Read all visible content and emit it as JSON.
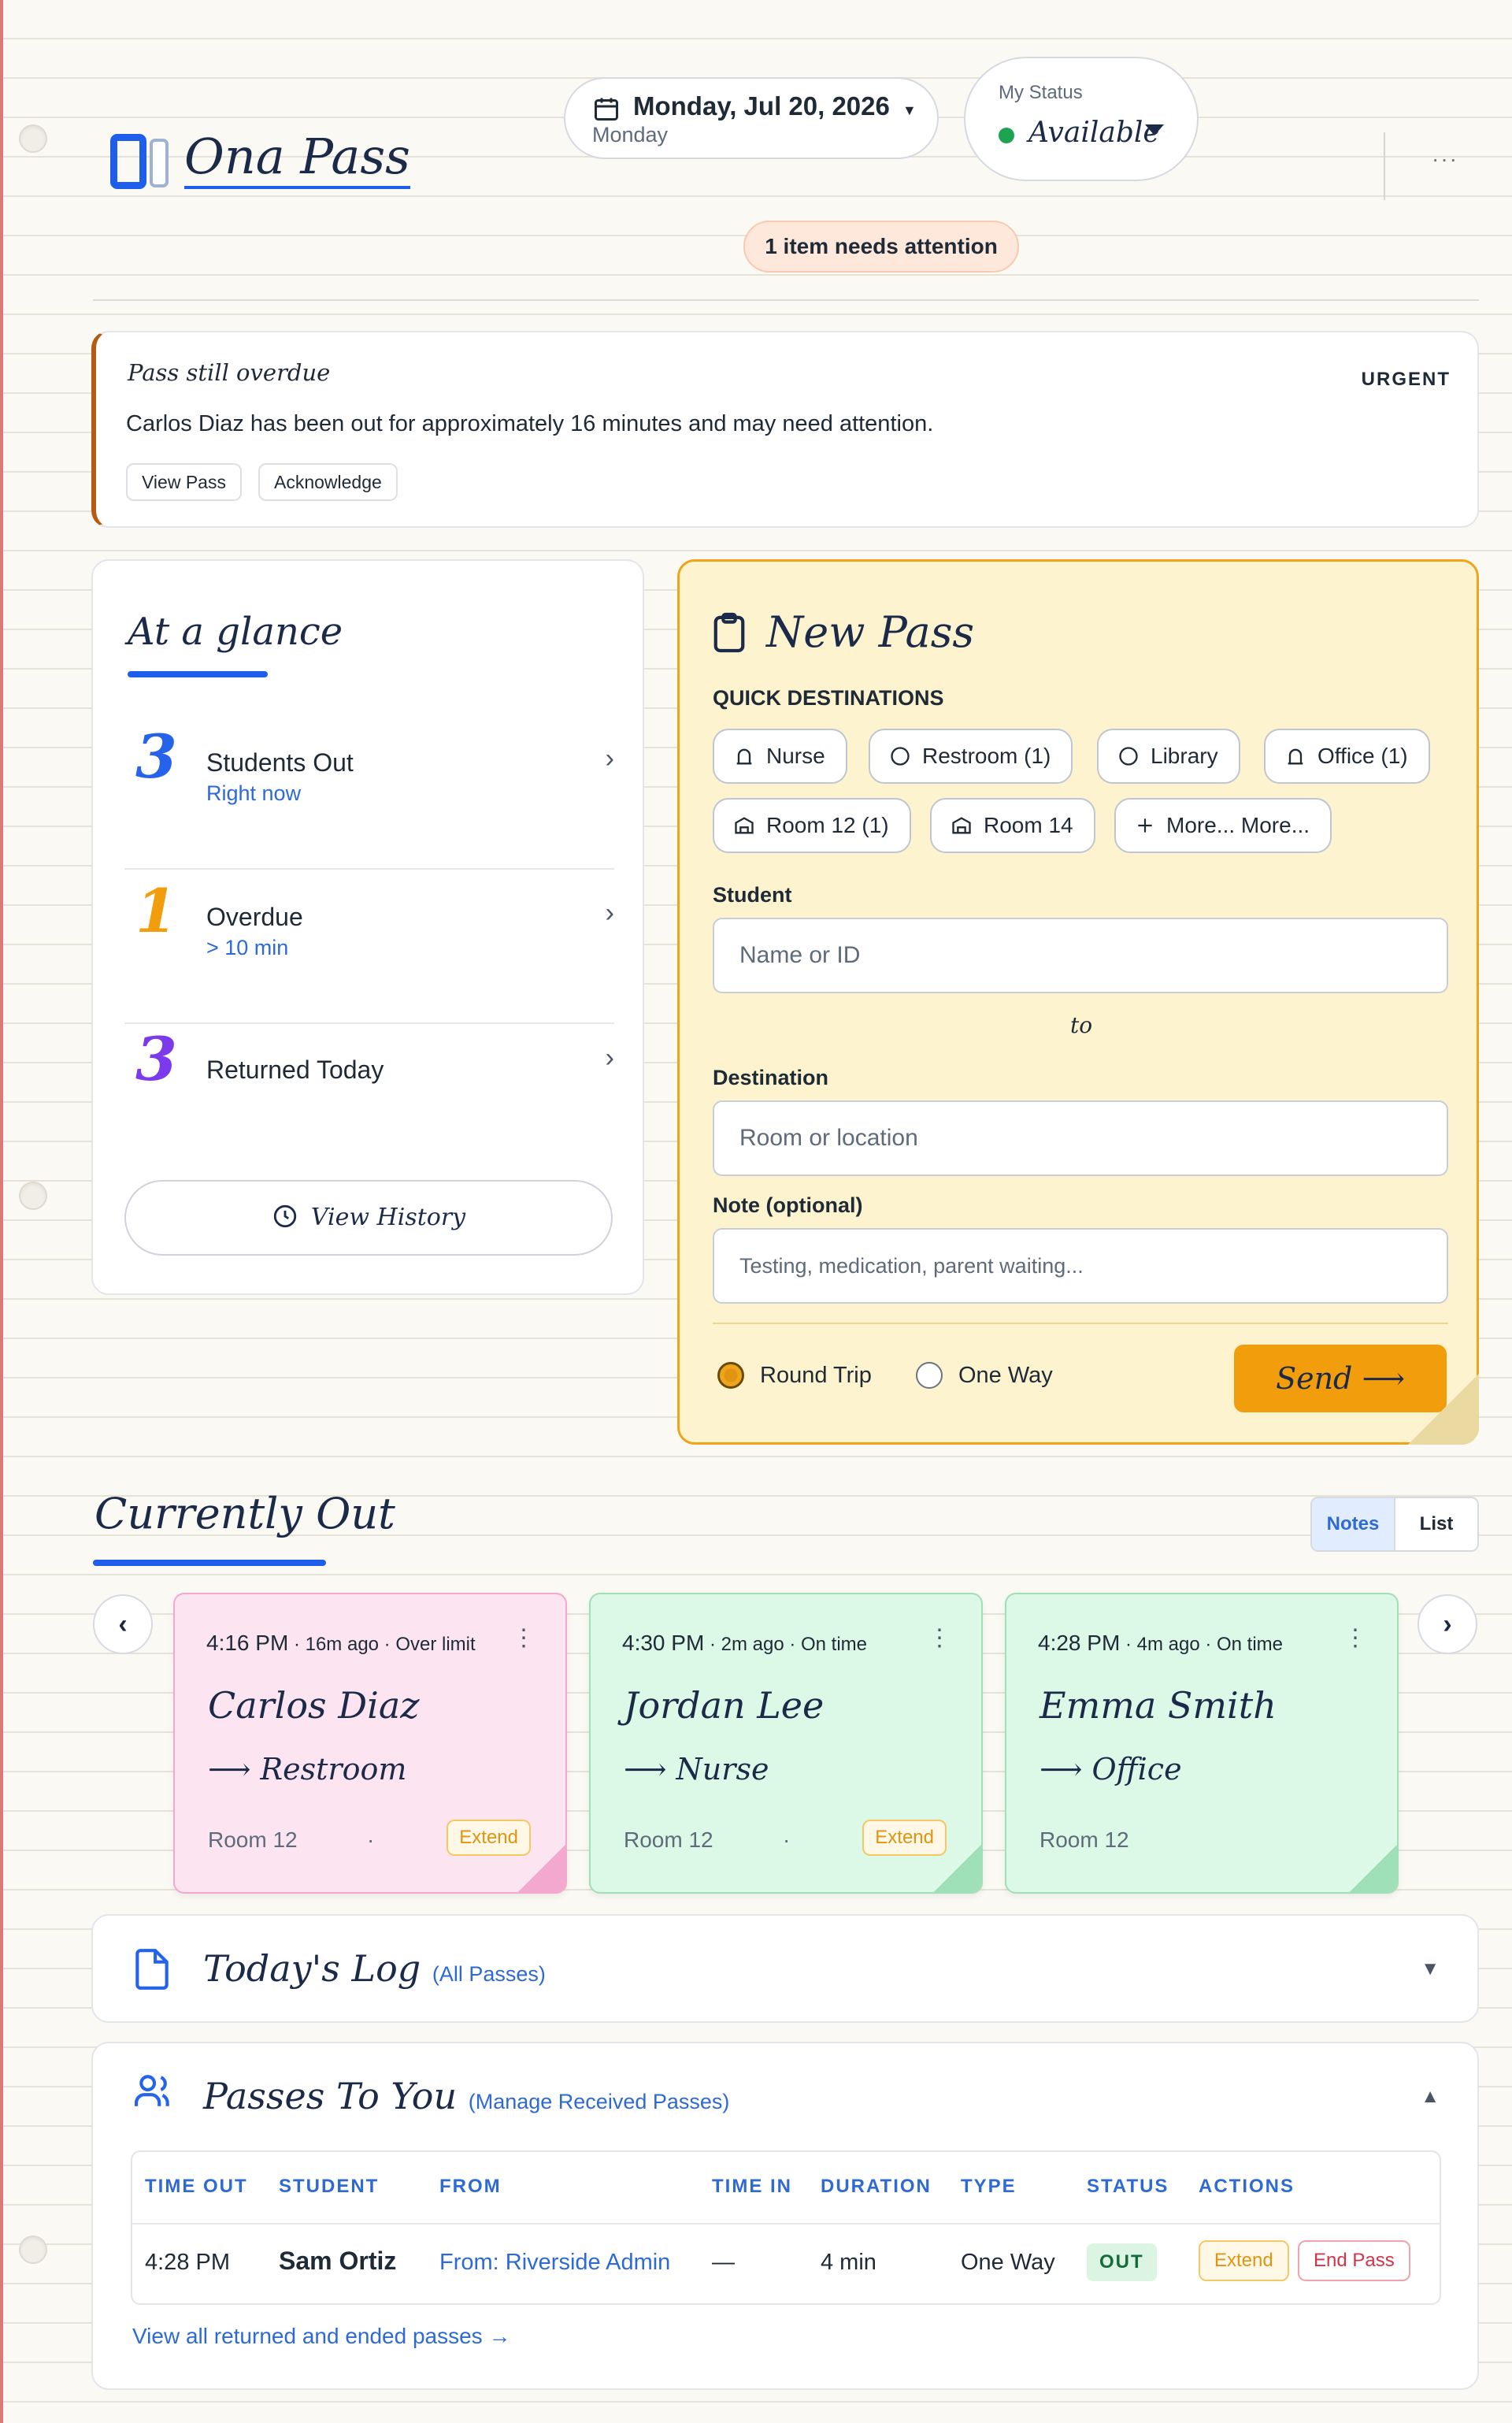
{
  "app": {
    "name": "Ona Pass"
  },
  "header": {
    "date_main": "Monday, Jul 20, 2026",
    "date_sub": "Monday",
    "status_label": "My Status",
    "status_value": "Available",
    "attention": "1 item needs attention",
    "more": "···"
  },
  "alert": {
    "title": "Pass still overdue",
    "badge": "URGENT",
    "message": "Carlos Diaz has been out for approximately 16 minutes and may need attention.",
    "view_button": "View Pass",
    "ack_button": "Acknowledge"
  },
  "glance": {
    "title": "At a glance",
    "rows": [
      {
        "count": "3",
        "label": "Students Out",
        "sub": "Right now",
        "color": "#2563eb"
      },
      {
        "count": "1",
        "label": "Overdue",
        "sub": "> 10 min",
        "color": "#f29d0c"
      },
      {
        "count": "3",
        "label": "Returned Today",
        "sub": "",
        "color": "#7c3aed"
      }
    ],
    "history_button": "View History"
  },
  "new_pass": {
    "title": "New Pass",
    "quick_label": "QUICK DESTINATIONS",
    "destinations": [
      {
        "label": "Nurse",
        "icon": "bell-icon"
      },
      {
        "label": "Restroom (1)",
        "icon": "circle-icon"
      },
      {
        "label": "Library",
        "icon": "circle-icon"
      },
      {
        "label": "Office (1)",
        "icon": "bell-icon"
      },
      {
        "label": "Room 12 (1)",
        "icon": "classroom-icon"
      },
      {
        "label": "Room 14",
        "icon": "classroom-icon"
      },
      {
        "label": "More... More...",
        "icon": "plus-icon"
      }
    ],
    "student_label": "Student",
    "student_placeholder": "Name or ID",
    "to_text": "to",
    "destination_label": "Destination",
    "destination_placeholder": "Room or location",
    "note_label": "Note (optional)",
    "note_placeholder": "Testing, medication, parent waiting...",
    "trip_options": [
      "Round Trip",
      "One Way"
    ],
    "trip_selected": "Round Trip",
    "send_label": "Send ⟶"
  },
  "currently_out": {
    "title": "Currently Out",
    "view_tabs": [
      "Notes",
      "List"
    ],
    "view_selected": "Notes",
    "prev": "‹",
    "next": "›",
    "notes": [
      {
        "time": "4:16 PM",
        "detail": " · 16m ago · Over limit",
        "student": "Carlos Diaz",
        "destination": "⟶ Restroom",
        "room": "Room 12",
        "extend": "Extend",
        "color": "#fde4f1",
        "border": "#f3a9cf"
      },
      {
        "time": "4:30 PM",
        "detail": " · 2m ago · On time",
        "student": "Jordan Lee",
        "destination": "⟶ Nurse",
        "room": "Room 12",
        "extend": "Extend",
        "color": "#dcf8e6",
        "border": "#9fe0b8"
      },
      {
        "time": "4:28 PM",
        "detail": " · 4m ago · On time",
        "student": "Emma Smith",
        "destination": "⟶ Office",
        "room": "Room 12",
        "extend": "",
        "color": "#dcf8e6",
        "border": "#9fe0b8"
      }
    ]
  },
  "todays_log": {
    "title": "Today's Log",
    "link": "(All Passes)"
  },
  "passes_to_you": {
    "title": "Passes To You",
    "link": "(Manage Received Passes)",
    "columns": [
      "TIME OUT",
      "STUDENT",
      "FROM",
      "TIME IN",
      "DURATION",
      "TYPE",
      "STATUS",
      "ACTIONS"
    ],
    "rows": [
      {
        "time_out": "4:28 PM",
        "student": "Sam Ortiz",
        "from": "From: Riverside Admin",
        "time_in": "—",
        "duration": "4 min",
        "type": "One Way",
        "status": "OUT",
        "extend": "Extend",
        "end": "End Pass"
      }
    ],
    "view_all": "View all returned and ended passes →"
  },
  "colors": {
    "accent": "#1e5eea",
    "warning": "#f29d0c",
    "danger": "#d4344a",
    "success": "#1ea352"
  }
}
